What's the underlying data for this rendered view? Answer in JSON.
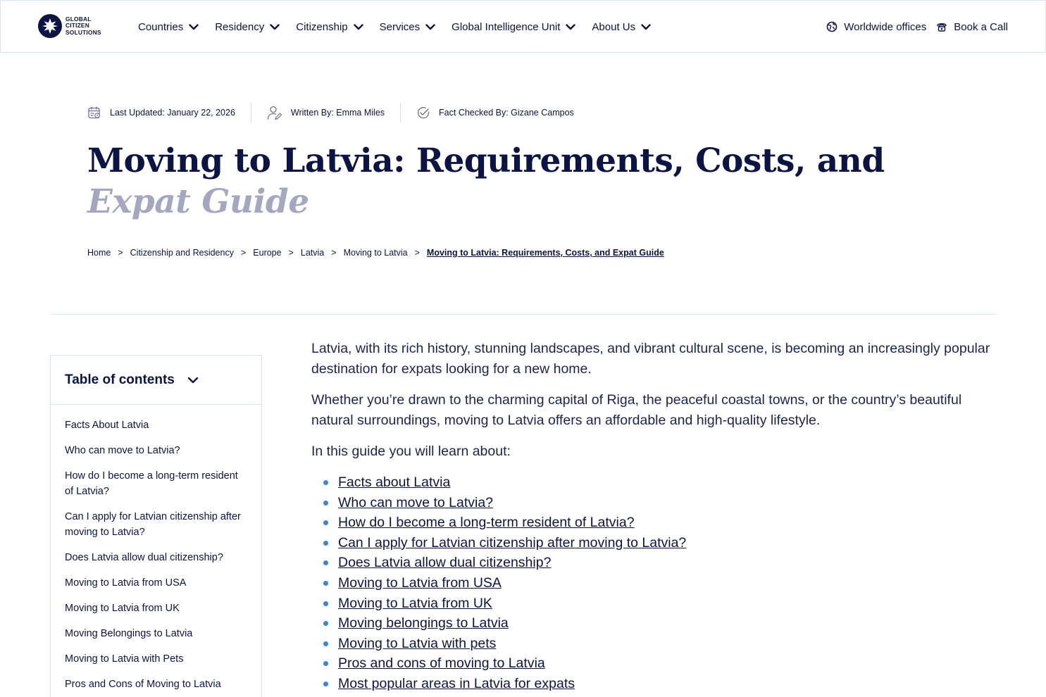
{
  "header": {
    "logo_lines": [
      "GLOBAL",
      "CITIZEN",
      "SOLUTIONS"
    ],
    "nav": [
      {
        "label": "Countries"
      },
      {
        "label": "Residency"
      },
      {
        "label": "Citizenship"
      },
      {
        "label": "Services"
      },
      {
        "label": "Global Intelligence Unit"
      },
      {
        "label": "About Us"
      }
    ],
    "worldwide_label": "Worldwide offices",
    "book_label": "Book a Call"
  },
  "meta": {
    "updated": "Last Updated: January 22, 2026",
    "written": "Written By: Emma Miles",
    "fact_checked": "Fact Checked By: Gizane Campos"
  },
  "title": {
    "main": "Moving to Latvia: Requirements, Costs, and",
    "sub": "Expat Guide"
  },
  "breadcrumb": {
    "items": [
      "Home",
      "Citizenship and Residency",
      "Europe",
      "Latvia",
      "Moving to Latvia"
    ],
    "separator": ">",
    "current": "Moving to Latvia: Requirements, Costs, and Expat Guide"
  },
  "toc": {
    "title": "Table of contents",
    "items": [
      "Facts About Latvia",
      "Who can move to Latvia?",
      "How do I become a long-term resident of Latvia?",
      "Can I apply for Latvian citizenship after moving to Latvia?",
      "Does Latvia allow dual citizenship?",
      "Moving to Latvia from USA",
      "Moving to Latvia from UK",
      "Moving Belongings to Latvia",
      "Moving to Latvia with Pets",
      "Pros and Cons of Moving to Latvia"
    ]
  },
  "article": {
    "intro1": "Latvia, with its rich history, stunning landscapes, and vibrant cultural scene, is becoming an increasingly popular destination for expats looking for a new home.",
    "intro2": "Whether you’re drawn to the charming capital of Riga, the peaceful coastal towns, or the country’s beautiful natural surroundings, moving to Latvia offers an affordable and high-quality lifestyle.",
    "learn": "In this guide you will learn about:",
    "links": [
      "Facts about Latvia",
      "Who can move to Latvia?",
      "How do I become a long-term resident of Latvia?",
      "Can I apply for Latvian citizenship after moving to Latvia?",
      "Does Latvia allow dual citizenship?",
      "Moving to Latvia from USA",
      "Moving to Latvia from UK",
      "Moving belongings to Latvia",
      "Moving to Latvia with pets",
      "Pros and cons of moving to Latvia",
      "Most popular areas in Latvia for expats"
    ]
  },
  "colors": {
    "navy": "#0b1442",
    "title_muted": "#a4a7bf",
    "bullet": "#3e82d6",
    "border": "#d9e4f2"
  }
}
